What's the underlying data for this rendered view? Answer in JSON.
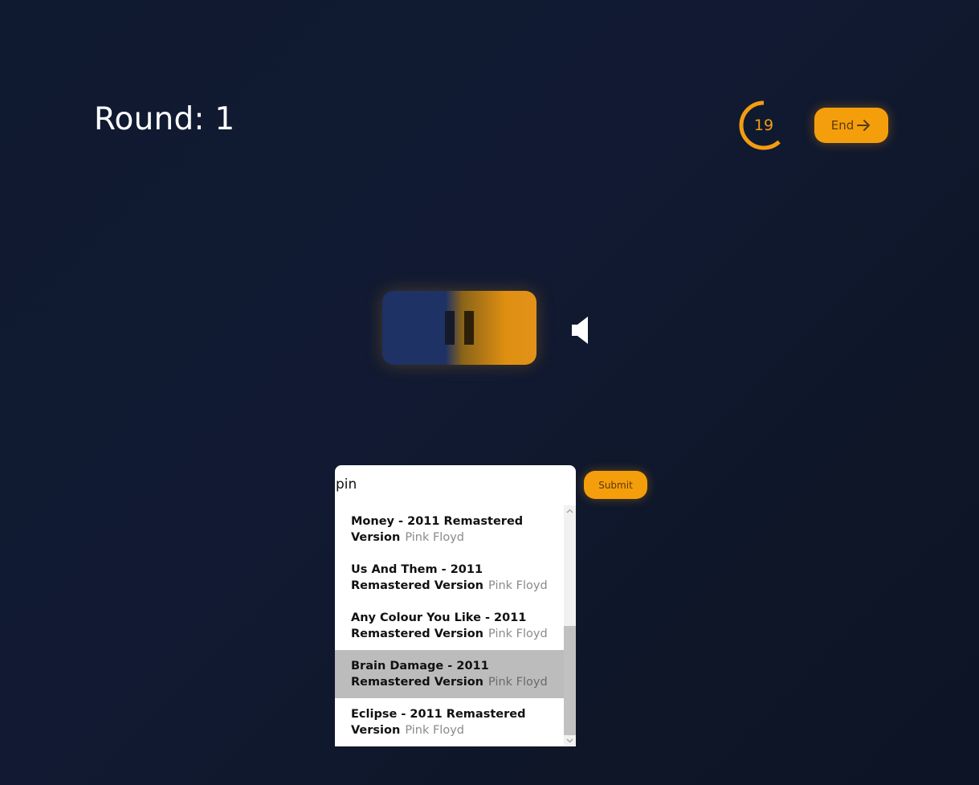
{
  "header": {
    "round_label": "Round: 1"
  },
  "timer": {
    "seconds_remaining": "19",
    "ring_fraction_remaining": 0.62
  },
  "end_button": {
    "label": "End",
    "icon": "arrow-right-icon"
  },
  "player": {
    "state_icon": "pause-icon",
    "playback_progress": 0.41,
    "volume_icon": "volume-icon"
  },
  "search": {
    "value": "pin",
    "results": [
      {
        "title": "Money - 2011 Remastered Version",
        "artist": "Pink Floyd",
        "highlighted": false
      },
      {
        "title": "Us And Them - 2011 Remastered Version",
        "artist": "Pink Floyd",
        "highlighted": false
      },
      {
        "title": "Any Colour You Like - 2011 Remastered Version",
        "artist": "Pink Floyd",
        "highlighted": false
      },
      {
        "title": "Brain Damage - 2011 Remastered Version",
        "artist": "Pink Floyd",
        "highlighted": true
      },
      {
        "title": "Eclipse - 2011 Remastered Version",
        "artist": "Pink Floyd",
        "highlighted": false
      }
    ]
  },
  "submit_button": {
    "label": "Submit"
  },
  "colors": {
    "accent": "#f59e0b",
    "background": "#111a32",
    "player_played": "#1e3266",
    "highlight_row": "#bcbcbc"
  }
}
